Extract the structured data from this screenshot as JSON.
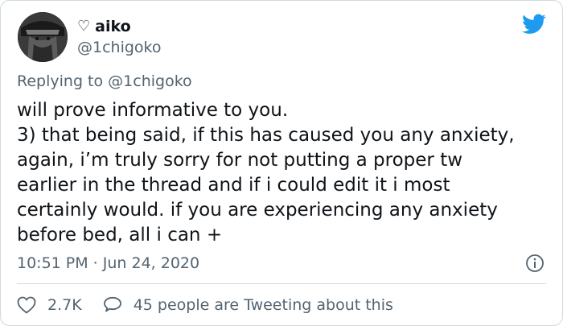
{
  "author": {
    "display_name": "aiko",
    "name_prefix_glyph": "♡",
    "handle": "@1chigoko"
  },
  "brand": {
    "icon": "twitter-bird-icon",
    "color": "#1d9bf0"
  },
  "reply_context": {
    "prefix": "Replying to",
    "mention": "@1chigoko"
  },
  "tweet": {
    "lines": [
      "will prove informative to you.",
      "3) that being said, if this has caused you any anxiety,",
      "again, i’m truly sorry for not putting a proper tw",
      "earlier in the thread and if i could edit it i most",
      "certainly would. if you are experiencing any anxiety",
      "before bed, all i can +"
    ],
    "timestamp": "10:51 PM · Jun 24, 2020"
  },
  "actions": {
    "like_count": "2.7K",
    "like_icon": "heart-icon",
    "conversation_label": "45 people are Tweeting about this",
    "conversation_icon": "speech-bubble-icon",
    "info_icon": "info-icon"
  },
  "colors": {
    "text": "#0f1419",
    "secondary": "#536471",
    "border": "#cfd9de"
  }
}
